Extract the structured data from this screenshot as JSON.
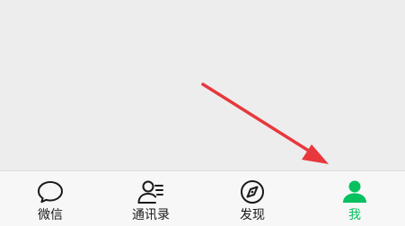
{
  "tabbar": {
    "items": [
      {
        "label": "微信",
        "icon": "chat-bubble-icon"
      },
      {
        "label": "通讯录",
        "icon": "contacts-icon"
      },
      {
        "label": "发现",
        "icon": "compass-icon"
      },
      {
        "label": "我",
        "icon": "person-icon",
        "active": true
      }
    ]
  },
  "colors": {
    "active": "#07c160",
    "inactive": "#1a1a1a",
    "arrow": "#e8383d",
    "background": "#ededed",
    "tabbar": "#f7f7f7"
  }
}
